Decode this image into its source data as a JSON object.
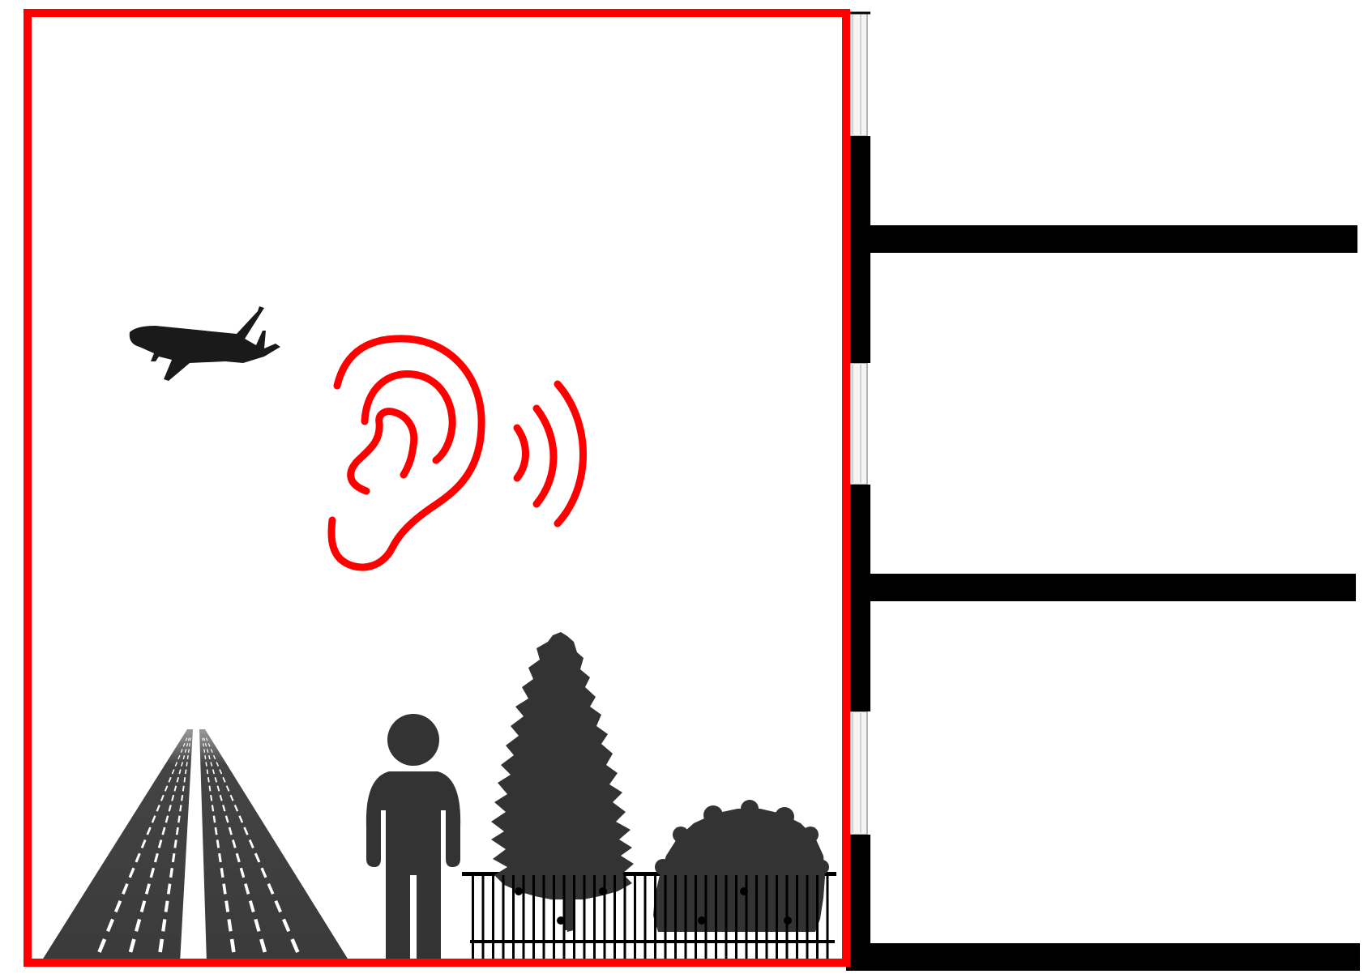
{
  "colors": {
    "frame": "#ff0000",
    "ear": "#ff0000",
    "silhouette": "#333333",
    "plane": "#1a1a1a",
    "building": "#000000",
    "window_glass": "#f4f4f4",
    "window_line": "#9a9a9a",
    "runway_marks": "#ffffff",
    "background": "#ffffff"
  },
  "icons": {
    "plane": "airplane-icon",
    "ear": "ear-icon",
    "sound": "sound-waves-icon",
    "person": "person-icon",
    "tree": "conifer-tree-icon",
    "bush": "bush-icon",
    "fence": "fence-railing",
    "runway": "runway",
    "building": "building-section"
  },
  "building": {
    "floors": 3
  }
}
